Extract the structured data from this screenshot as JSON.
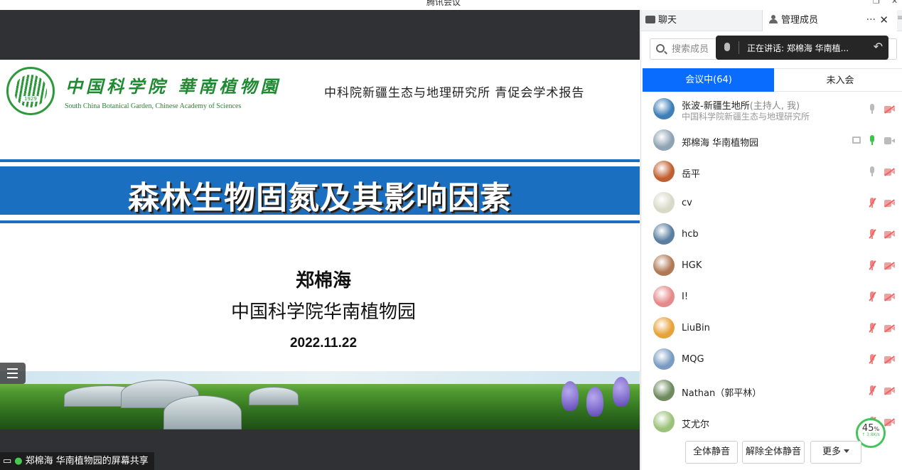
{
  "window": {
    "title": "腾讯会议"
  },
  "share": {
    "slide": {
      "logo_cn": "中国科学院 華南植物園",
      "logo_en": "South China Botanical Garden, Chinese Academy of Sciences",
      "logo_year": "1929",
      "header_right": "中科院新疆生态与地理研究所  青促会学术报告",
      "title": "森林生物固氮及其影响因素",
      "author": "郑棉海",
      "org": "中国科学院华南植物园",
      "date": "2022.11.22"
    },
    "sharer_label": "郑棉海 华南植物园的屏幕共享"
  },
  "panel": {
    "tabs": {
      "chat": "聊天",
      "members": "管理成员"
    },
    "search": {
      "placeholder": "搜索成员"
    },
    "speaker_toast": "正在讲话: 郑棉海 华南植...",
    "segments": {
      "in_meeting": "会议中(64)",
      "not_joined": "未入会"
    },
    "members": [
      {
        "name": "张波-新疆生地所",
        "role": "(主持人, 我)",
        "org": "中国科学院新疆生态与地理研究所",
        "mic": "available",
        "camera": "off",
        "avatar_color": "#3f7fb8"
      },
      {
        "name": "郑棉海 华南植物园",
        "role": "",
        "org": "",
        "mic": "speaking",
        "camera": "available",
        "sharing": true,
        "avatar_color": "#8fa3b3"
      },
      {
        "name": "岳平",
        "role": "",
        "org": "",
        "mic": "available",
        "camera": "off",
        "avatar_color": "#c06030"
      },
      {
        "name": "cv",
        "role": "",
        "org": "",
        "mic": "muted",
        "camera": "off",
        "avatar_color": "#d9d9c8"
      },
      {
        "name": "hcb",
        "role": "",
        "org": "",
        "mic": "muted",
        "camera": "off",
        "avatar_color": "#5a7fa0"
      },
      {
        "name": "HGK",
        "role": "",
        "org": "",
        "mic": "muted",
        "camera": "off",
        "avatar_color": "#b07a55"
      },
      {
        "name": "I!",
        "role": "",
        "org": "",
        "mic": "muted",
        "camera": "off",
        "avatar_color": "#e58a8a"
      },
      {
        "name": "LiuBin",
        "role": "",
        "org": "",
        "mic": "muted",
        "camera": "off",
        "avatar_color": "#e8a23a"
      },
      {
        "name": "MQG",
        "role": "",
        "org": "",
        "mic": "muted",
        "camera": "off",
        "avatar_color": "#7a9cc2"
      },
      {
        "name": "Nathan（郭平林）",
        "role": "",
        "org": "",
        "mic": "muted",
        "camera": "off",
        "avatar_color": "#6f8a5f"
      },
      {
        "name": "艾尤尔",
        "role": "",
        "org": "",
        "mic": "muted",
        "camera": "off",
        "avatar_color": "#9bc27a"
      }
    ],
    "network": {
      "percent": "45",
      "percent_unit": "%",
      "speed": "↑ 3.8K/s"
    },
    "footer": {
      "mute_all": "全体静音",
      "unmute_all": "解除全体静音",
      "more": "更多"
    }
  },
  "colors": {
    "accent": "#0a6cff",
    "slide_band": "#1b6fc0",
    "logo_green": "#1f8a32",
    "speaking_green": "#3fc24a"
  }
}
